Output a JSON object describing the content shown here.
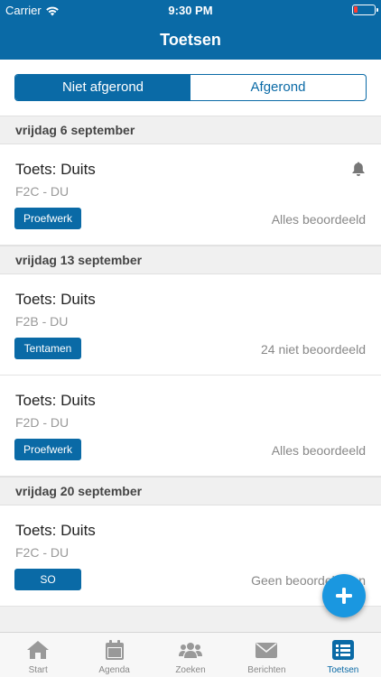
{
  "status_bar": {
    "carrier": "Carrier",
    "time": "9:30 PM"
  },
  "nav": {
    "title": "Toetsen"
  },
  "segment": {
    "options": [
      "Niet afgerond",
      "Afgerond"
    ],
    "selected": "Niet afgerond"
  },
  "sections": [
    {
      "date": "vrijdag 6 september",
      "items": [
        {
          "title": "Toets: Duits",
          "subtitle": "F2C - DU",
          "badge": "Proefwerk",
          "status": "Alles beoordeeld",
          "bell": true
        }
      ]
    },
    {
      "date": "vrijdag 13 september",
      "items": [
        {
          "title": "Toets: Duits",
          "subtitle": "F2B - DU",
          "badge": "Tentamen",
          "status": "24 niet beoordeeld"
        },
        {
          "title": "Toets: Duits",
          "subtitle": "F2D - DU",
          "badge": "Proefwerk",
          "status": "Alles beoordeeld"
        }
      ]
    },
    {
      "date": "vrijdag 20 september",
      "items": [
        {
          "title": "Toets: Duits",
          "subtitle": "F2C - DU",
          "badge": "SO",
          "status": "Geen beoordelingen"
        }
      ]
    }
  ],
  "tabbar": {
    "items": [
      {
        "label": "Start",
        "icon": "home-icon"
      },
      {
        "label": "Agenda",
        "icon": "calendar-icon"
      },
      {
        "label": "Zoeken",
        "icon": "people-icon"
      },
      {
        "label": "Berichten",
        "icon": "mail-icon"
      },
      {
        "label": "Toetsen",
        "icon": "list-icon"
      }
    ],
    "active": "Toetsen"
  },
  "colors": {
    "primary": "#0a6aa6",
    "fab": "#1a97e0",
    "battery_low": "#ff3b30"
  }
}
